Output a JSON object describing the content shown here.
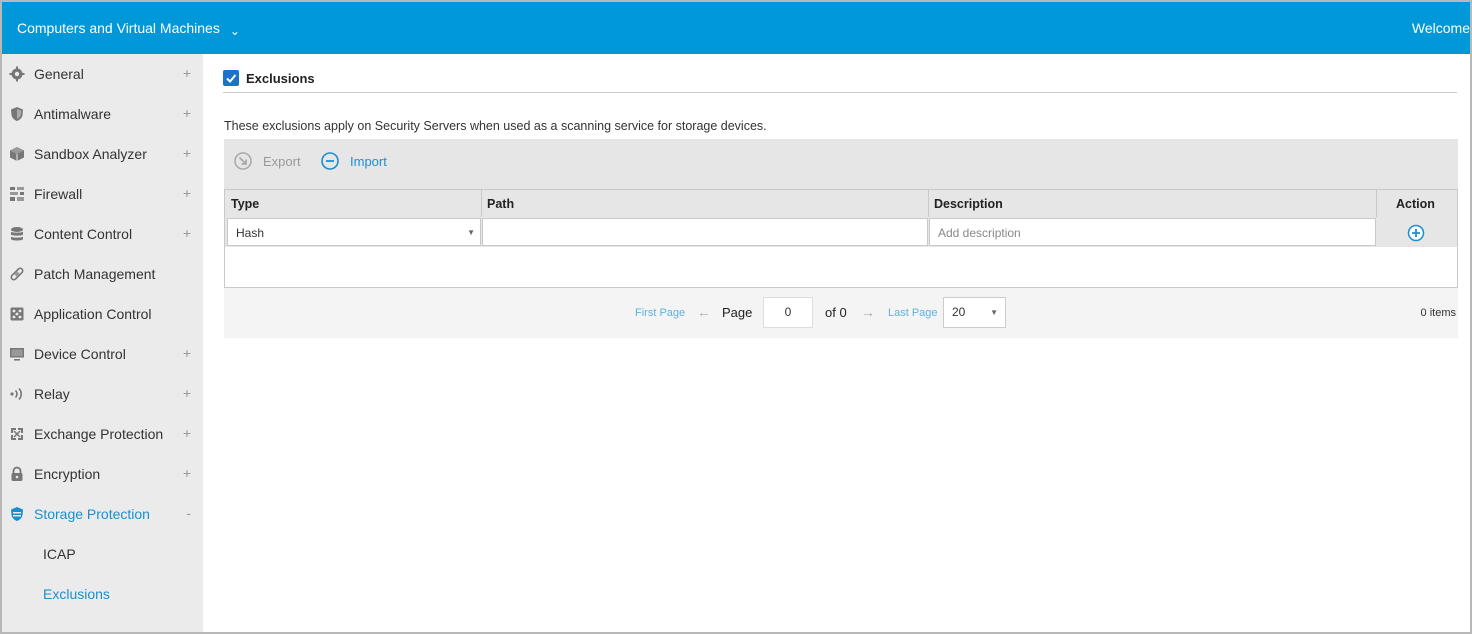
{
  "header": {
    "context_label": "Computers and Virtual Machines",
    "welcome": "Welcome"
  },
  "sidebar": {
    "items": [
      {
        "label": "General",
        "icon": "gear-icon",
        "expand": "+"
      },
      {
        "label": "Antimalware",
        "icon": "shield-icon",
        "expand": "+"
      },
      {
        "label": "Sandbox Analyzer",
        "icon": "cube-icon",
        "expand": "+"
      },
      {
        "label": "Firewall",
        "icon": "firewall-icon",
        "expand": "+"
      },
      {
        "label": "Content Control",
        "icon": "database-icon",
        "expand": "+"
      },
      {
        "label": "Patch Management",
        "icon": "bandage-icon",
        "expand": ""
      },
      {
        "label": "Application Control",
        "icon": "app-icon",
        "expand": ""
      },
      {
        "label": "Device Control",
        "icon": "monitor-icon",
        "expand": "+"
      },
      {
        "label": "Relay",
        "icon": "signal-icon",
        "expand": "+"
      },
      {
        "label": "Exchange Protection",
        "icon": "exchange-icon",
        "expand": "+"
      },
      {
        "label": "Encryption",
        "icon": "lock-icon",
        "expand": "+"
      },
      {
        "label": "Storage Protection",
        "icon": "storage-icon",
        "expand": "-"
      }
    ],
    "subitems": [
      {
        "label": "ICAP"
      },
      {
        "label": "Exclusions"
      }
    ],
    "active_color": "#1a8fd0"
  },
  "section": {
    "title": "Exclusions",
    "checked": true,
    "description": "These exclusions apply on Security Servers when used as a scanning service for storage devices."
  },
  "toolbar": {
    "export_label": "Export",
    "import_label": "Import"
  },
  "table": {
    "columns": [
      "Type",
      "Path",
      "Description",
      "Action"
    ],
    "new_row": {
      "type_value": "Hash",
      "path_value": "",
      "description_placeholder": "Add description"
    }
  },
  "pager": {
    "first_page": "First Page",
    "page_label": "Page",
    "page_value": "0",
    "of_label": "of 0",
    "last_page": "Last Page",
    "page_size": "20",
    "items_count": "0 items"
  },
  "colors": {
    "topbar": "#0098d9",
    "accent": "#1a8fd0"
  }
}
